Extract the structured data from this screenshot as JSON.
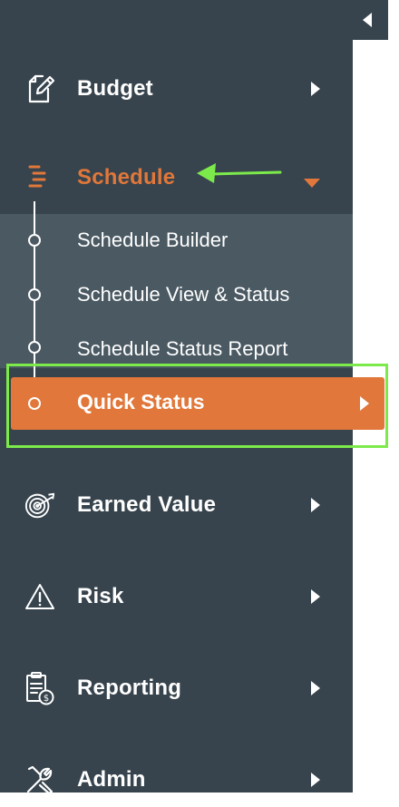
{
  "sidebar": {
    "items": [
      {
        "label": "Budget",
        "icon": "edit-document-icon"
      },
      {
        "label": "Schedule",
        "icon": "schedule-list-icon",
        "expanded": true
      },
      {
        "label": "Earned Value",
        "icon": "target-icon"
      },
      {
        "label": "Risk",
        "icon": "warning-triangle-icon"
      },
      {
        "label": "Reporting",
        "icon": "report-clipboard-icon"
      },
      {
        "label": "Admin",
        "icon": "tools-icon"
      }
    ],
    "schedule_submenu": [
      {
        "label": "Schedule Builder"
      },
      {
        "label": "Schedule View & Status"
      },
      {
        "label": "Schedule Status Report"
      },
      {
        "label": "Quick Status",
        "active": true
      }
    ]
  },
  "colors": {
    "sidebar_bg": "#37444d",
    "submenu_bg": "#4a5962",
    "accent_orange": "#e1773a",
    "annotation_green": "#7dea4c",
    "text": "#ffffff"
  }
}
